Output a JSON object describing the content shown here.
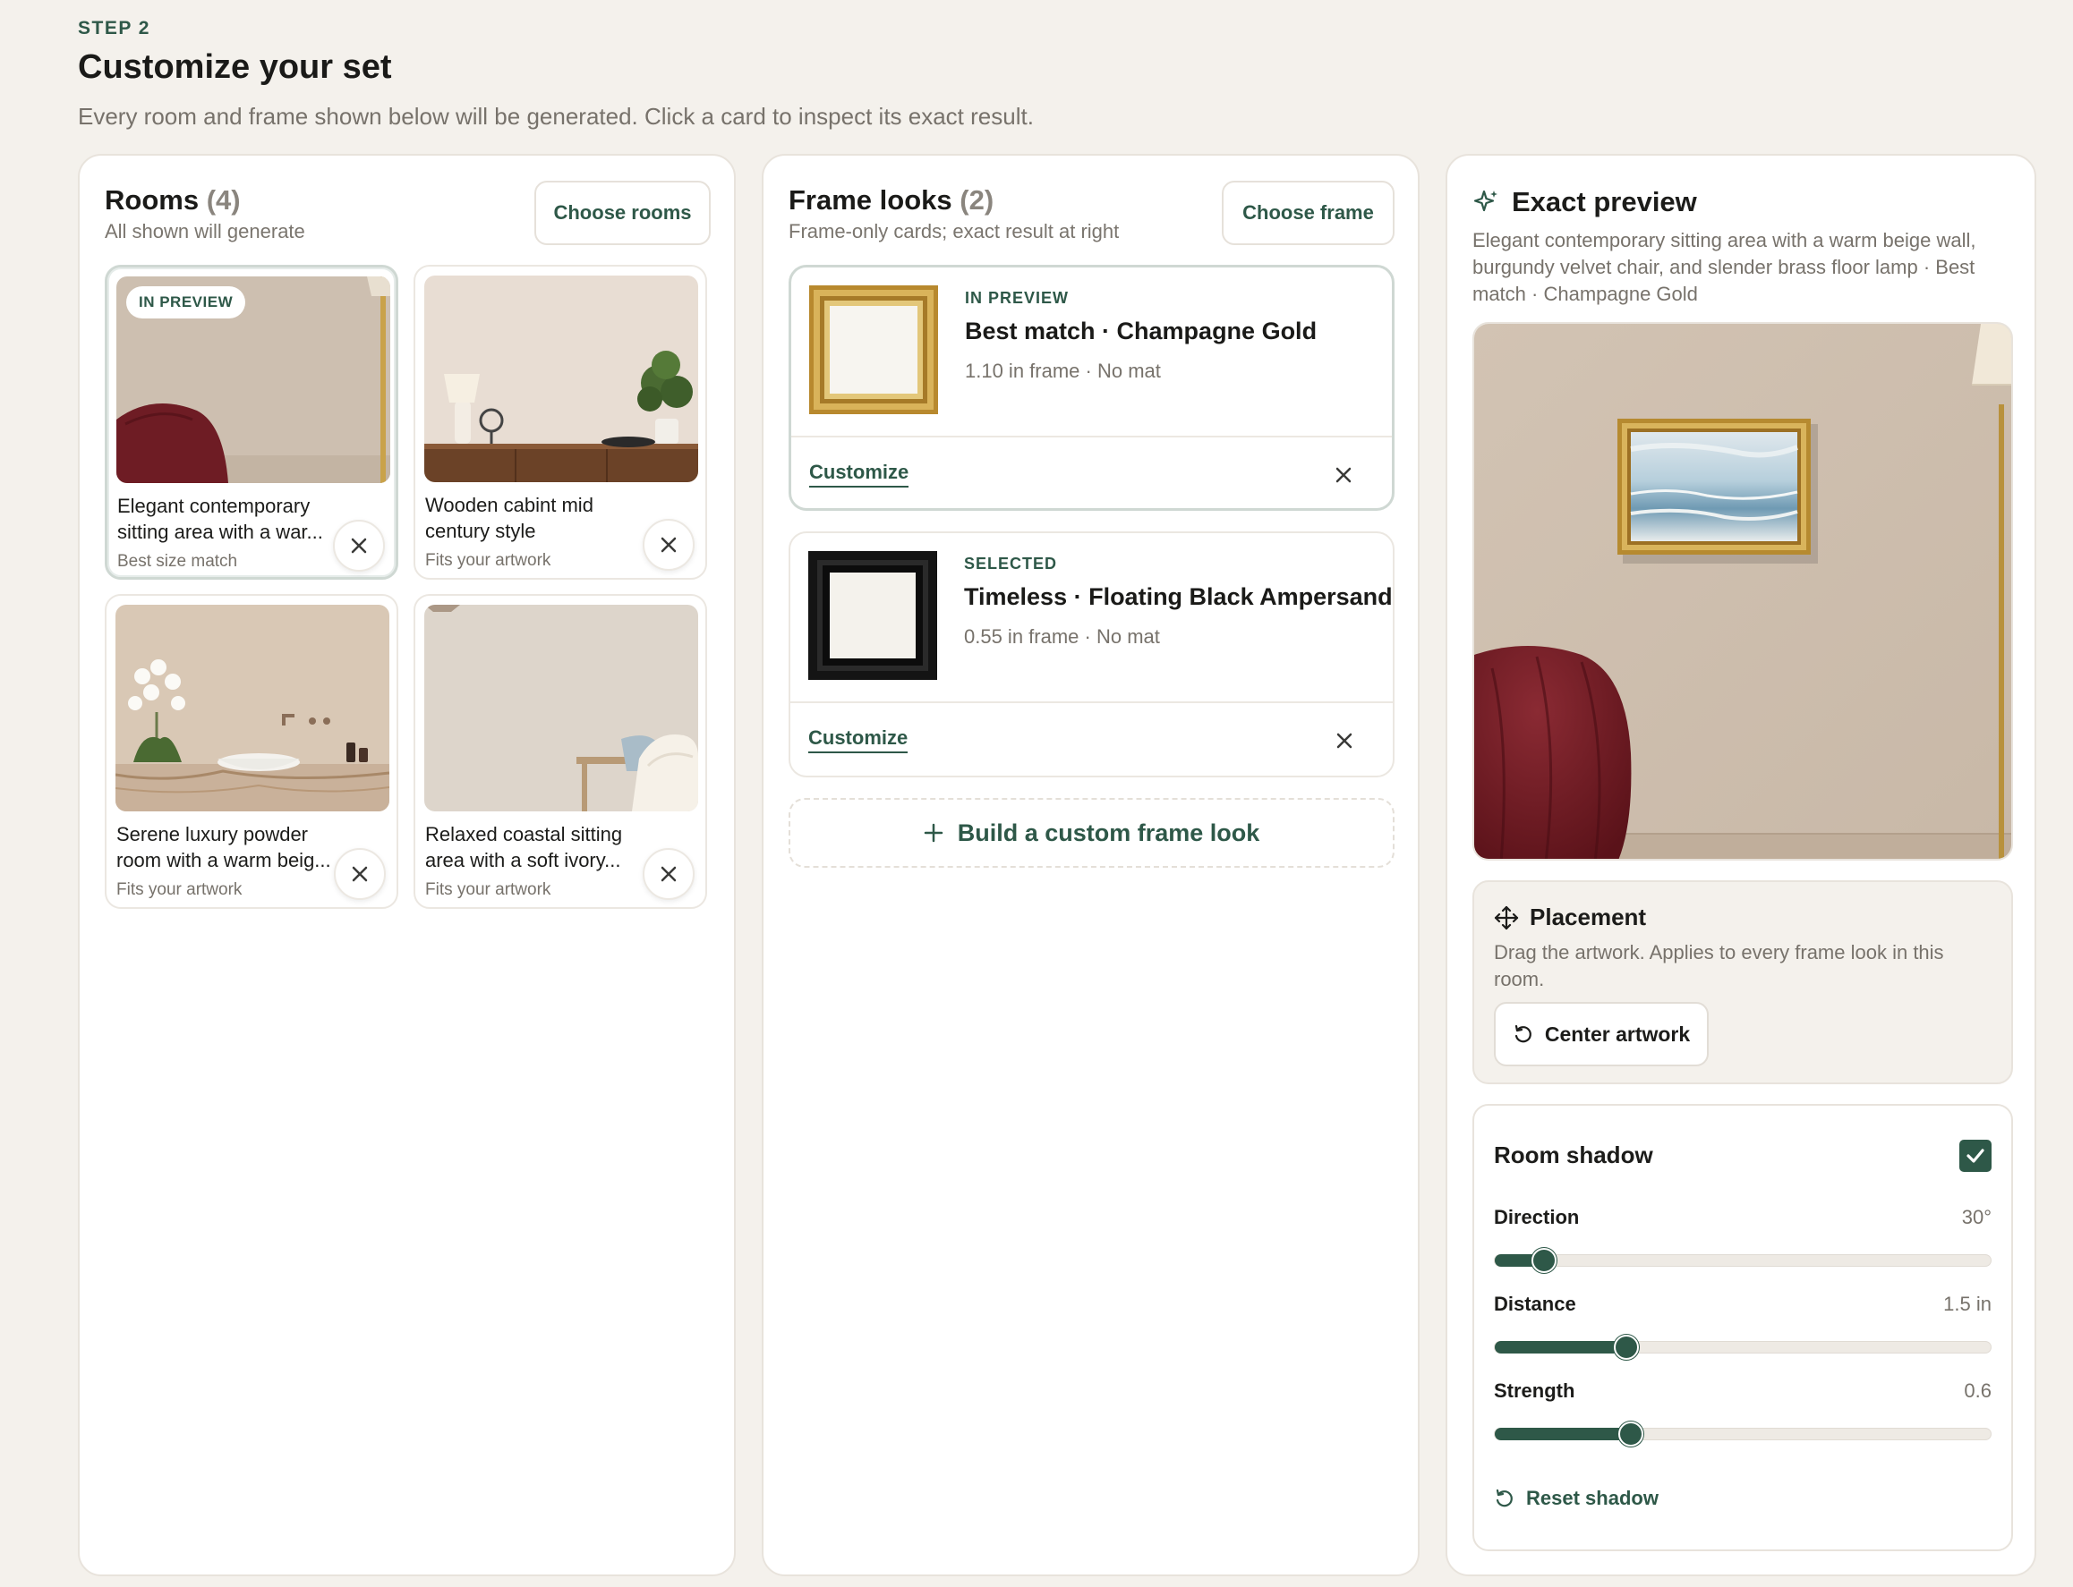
{
  "header": {
    "step": "STEP 2",
    "title": "Customize your set",
    "subtitle": "Every room and frame shown below will be generated. Click a card to inspect its exact result."
  },
  "rooms": {
    "title": "Rooms",
    "count": "(4)",
    "subtitle": "All shown will generate",
    "choose_label": "Choose rooms",
    "preview_tag": "IN PREVIEW",
    "items": [
      {
        "name": "Elegant contemporary sitting area with a war...",
        "meta": "Best size match"
      },
      {
        "name": "Wooden cabint mid century style",
        "meta": "Fits your artwork"
      },
      {
        "name": "Serene luxury powder room with a warm beig...",
        "meta": "Fits your artwork"
      },
      {
        "name": "Relaxed coastal sitting area with a soft ivory...",
        "meta": "Fits your artwork"
      }
    ]
  },
  "frames": {
    "title": "Frame looks",
    "count": "(2)",
    "subtitle": "Frame-only cards; exact result at right",
    "choose_label": "Choose frame",
    "items": [
      {
        "label": "IN PREVIEW",
        "name": "Best match · Champagne Gold",
        "meta": "1.10 in frame · No mat",
        "customize": "Customize"
      },
      {
        "label": "SELECTED",
        "name": "Timeless · Floating Black Ampersand",
        "meta": "0.55 in frame · No mat",
        "customize": "Customize"
      }
    ],
    "build_label": "Build a custom frame look"
  },
  "preview": {
    "title": "Exact preview",
    "description": "Elegant contemporary sitting area with a warm beige wall, burgundy velvet chair, and slender brass floor lamp · Best match · Champagne Gold",
    "placement": {
      "title": "Placement",
      "description": "Drag the artwork. Applies to every frame look in this room.",
      "center_label": "Center artwork"
    },
    "shadow": {
      "title": "Room shadow",
      "enabled": true,
      "direction": {
        "label": "Direction",
        "value": "30°",
        "fraction": 0.1
      },
      "distance": {
        "label": "Distance",
        "value": "1.5 in",
        "fraction": 0.265
      },
      "strength": {
        "label": "Strength",
        "value": "0.6",
        "fraction": 0.275
      },
      "reset_label": "Reset shadow"
    }
  },
  "colors": {
    "accent": "#2e5848",
    "background": "#f4f1ec",
    "burgundy": "#6e1c24",
    "gold": "#c9a24a"
  }
}
